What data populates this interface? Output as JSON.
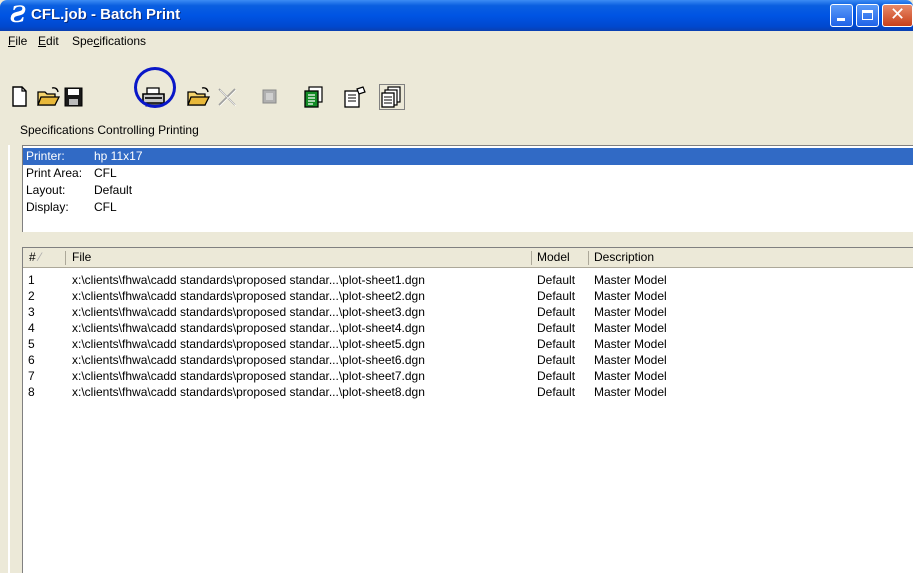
{
  "window": {
    "title": "CFL.job - Batch Print",
    "icon": "microstation-icon"
  },
  "menu": {
    "file": {
      "key": "F",
      "rest": "ile"
    },
    "edit": {
      "key": "E",
      "rest": "dit"
    },
    "specifications": {
      "pre": "Spe",
      "key": "c",
      "rest": "ifications"
    }
  },
  "toolbar": {
    "buttons": [
      "new-icon",
      "open-icon",
      "save-icon",
      "print-icon",
      "open-specifications-icon",
      "delete-icon",
      "disabled-icon",
      "properties-icon",
      "specification-icon",
      "multiple-pages-icon"
    ],
    "highlight_color": "#0a17c8"
  },
  "specs": {
    "label": "Specifications Controlling Printing",
    "rows": [
      {
        "key": "Printer:",
        "value": "hp 11x17"
      },
      {
        "key": "Print Area:",
        "value": "CFL"
      },
      {
        "key": "Layout:",
        "value": "Default"
      },
      {
        "key": "Display:",
        "value": "CFL"
      }
    ],
    "selected_color": "#316ac5"
  },
  "list": {
    "columns": {
      "num": "#",
      "file": "File",
      "model": "Model",
      "desc": "Description"
    },
    "rows": [
      {
        "num": "1",
        "file": "x:\\clients\\fhwa\\cadd standards\\proposed standar...\\plot-sheet1.dgn",
        "model": "Default",
        "desc": "Master Model"
      },
      {
        "num": "2",
        "file": "x:\\clients\\fhwa\\cadd standards\\proposed standar...\\plot-sheet2.dgn",
        "model": "Default",
        "desc": "Master Model"
      },
      {
        "num": "3",
        "file": "x:\\clients\\fhwa\\cadd standards\\proposed standar...\\plot-sheet3.dgn",
        "model": "Default",
        "desc": "Master Model"
      },
      {
        "num": "4",
        "file": "x:\\clients\\fhwa\\cadd standards\\proposed standar...\\plot-sheet4.dgn",
        "model": "Default",
        "desc": "Master Model"
      },
      {
        "num": "5",
        "file": "x:\\clients\\fhwa\\cadd standards\\proposed standar...\\plot-sheet5.dgn",
        "model": "Default",
        "desc": "Master Model"
      },
      {
        "num": "6",
        "file": "x:\\clients\\fhwa\\cadd standards\\proposed standar...\\plot-sheet6.dgn",
        "model": "Default",
        "desc": "Master Model"
      },
      {
        "num": "7",
        "file": "x:\\clients\\fhwa\\cadd standards\\proposed standar...\\plot-sheet7.dgn",
        "model": "Default",
        "desc": "Master Model"
      },
      {
        "num": "8",
        "file": "x:\\clients\\fhwa\\cadd standards\\proposed standar...\\plot-sheet8.dgn",
        "model": "Default",
        "desc": "Master Model"
      }
    ]
  }
}
